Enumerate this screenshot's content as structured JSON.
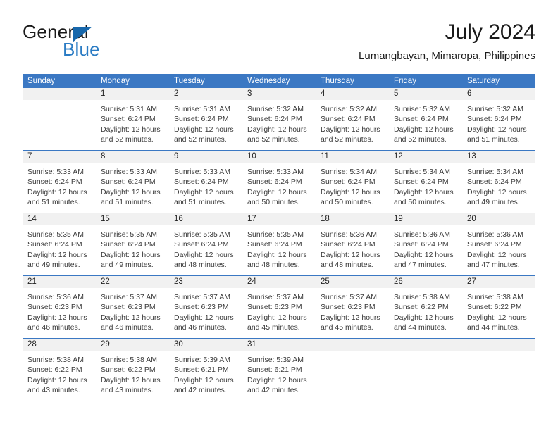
{
  "brand": {
    "name_part1": "General",
    "name_part2": "Blue",
    "triangle_color": "#1767ab",
    "blue_color": "#2b7cc4"
  },
  "header": {
    "title": "July 2024",
    "subtitle": "Lumangbayan, Mimaropa, Philippines"
  },
  "theme": {
    "header_blue": "#3b78c3",
    "daynum_gray": "#f1f1f1",
    "text": "#222222"
  },
  "weekdays": [
    "Sunday",
    "Monday",
    "Tuesday",
    "Wednesday",
    "Thursday",
    "Friday",
    "Saturday"
  ],
  "weeks": [
    [
      {
        "day": "",
        "sunrise": "",
        "sunset": "",
        "daylight1": "",
        "daylight2": ""
      },
      {
        "day": "1",
        "sunrise": "Sunrise: 5:31 AM",
        "sunset": "Sunset: 6:24 PM",
        "daylight1": "Daylight: 12 hours",
        "daylight2": "and 52 minutes."
      },
      {
        "day": "2",
        "sunrise": "Sunrise: 5:31 AM",
        "sunset": "Sunset: 6:24 PM",
        "daylight1": "Daylight: 12 hours",
        "daylight2": "and 52 minutes."
      },
      {
        "day": "3",
        "sunrise": "Sunrise: 5:32 AM",
        "sunset": "Sunset: 6:24 PM",
        "daylight1": "Daylight: 12 hours",
        "daylight2": "and 52 minutes."
      },
      {
        "day": "4",
        "sunrise": "Sunrise: 5:32 AM",
        "sunset": "Sunset: 6:24 PM",
        "daylight1": "Daylight: 12 hours",
        "daylight2": "and 52 minutes."
      },
      {
        "day": "5",
        "sunrise": "Sunrise: 5:32 AM",
        "sunset": "Sunset: 6:24 PM",
        "daylight1": "Daylight: 12 hours",
        "daylight2": "and 52 minutes."
      },
      {
        "day": "6",
        "sunrise": "Sunrise: 5:32 AM",
        "sunset": "Sunset: 6:24 PM",
        "daylight1": "Daylight: 12 hours",
        "daylight2": "and 51 minutes."
      }
    ],
    [
      {
        "day": "7",
        "sunrise": "Sunrise: 5:33 AM",
        "sunset": "Sunset: 6:24 PM",
        "daylight1": "Daylight: 12 hours",
        "daylight2": "and 51 minutes."
      },
      {
        "day": "8",
        "sunrise": "Sunrise: 5:33 AM",
        "sunset": "Sunset: 6:24 PM",
        "daylight1": "Daylight: 12 hours",
        "daylight2": "and 51 minutes."
      },
      {
        "day": "9",
        "sunrise": "Sunrise: 5:33 AM",
        "sunset": "Sunset: 6:24 PM",
        "daylight1": "Daylight: 12 hours",
        "daylight2": "and 51 minutes."
      },
      {
        "day": "10",
        "sunrise": "Sunrise: 5:33 AM",
        "sunset": "Sunset: 6:24 PM",
        "daylight1": "Daylight: 12 hours",
        "daylight2": "and 50 minutes."
      },
      {
        "day": "11",
        "sunrise": "Sunrise: 5:34 AM",
        "sunset": "Sunset: 6:24 PM",
        "daylight1": "Daylight: 12 hours",
        "daylight2": "and 50 minutes."
      },
      {
        "day": "12",
        "sunrise": "Sunrise: 5:34 AM",
        "sunset": "Sunset: 6:24 PM",
        "daylight1": "Daylight: 12 hours",
        "daylight2": "and 50 minutes."
      },
      {
        "day": "13",
        "sunrise": "Sunrise: 5:34 AM",
        "sunset": "Sunset: 6:24 PM",
        "daylight1": "Daylight: 12 hours",
        "daylight2": "and 49 minutes."
      }
    ],
    [
      {
        "day": "14",
        "sunrise": "Sunrise: 5:35 AM",
        "sunset": "Sunset: 6:24 PM",
        "daylight1": "Daylight: 12 hours",
        "daylight2": "and 49 minutes."
      },
      {
        "day": "15",
        "sunrise": "Sunrise: 5:35 AM",
        "sunset": "Sunset: 6:24 PM",
        "daylight1": "Daylight: 12 hours",
        "daylight2": "and 49 minutes."
      },
      {
        "day": "16",
        "sunrise": "Sunrise: 5:35 AM",
        "sunset": "Sunset: 6:24 PM",
        "daylight1": "Daylight: 12 hours",
        "daylight2": "and 48 minutes."
      },
      {
        "day": "17",
        "sunrise": "Sunrise: 5:35 AM",
        "sunset": "Sunset: 6:24 PM",
        "daylight1": "Daylight: 12 hours",
        "daylight2": "and 48 minutes."
      },
      {
        "day": "18",
        "sunrise": "Sunrise: 5:36 AM",
        "sunset": "Sunset: 6:24 PM",
        "daylight1": "Daylight: 12 hours",
        "daylight2": "and 48 minutes."
      },
      {
        "day": "19",
        "sunrise": "Sunrise: 5:36 AM",
        "sunset": "Sunset: 6:24 PM",
        "daylight1": "Daylight: 12 hours",
        "daylight2": "and 47 minutes."
      },
      {
        "day": "20",
        "sunrise": "Sunrise: 5:36 AM",
        "sunset": "Sunset: 6:24 PM",
        "daylight1": "Daylight: 12 hours",
        "daylight2": "and 47 minutes."
      }
    ],
    [
      {
        "day": "21",
        "sunrise": "Sunrise: 5:36 AM",
        "sunset": "Sunset: 6:23 PM",
        "daylight1": "Daylight: 12 hours",
        "daylight2": "and 46 minutes."
      },
      {
        "day": "22",
        "sunrise": "Sunrise: 5:37 AM",
        "sunset": "Sunset: 6:23 PM",
        "daylight1": "Daylight: 12 hours",
        "daylight2": "and 46 minutes."
      },
      {
        "day": "23",
        "sunrise": "Sunrise: 5:37 AM",
        "sunset": "Sunset: 6:23 PM",
        "daylight1": "Daylight: 12 hours",
        "daylight2": "and 46 minutes."
      },
      {
        "day": "24",
        "sunrise": "Sunrise: 5:37 AM",
        "sunset": "Sunset: 6:23 PM",
        "daylight1": "Daylight: 12 hours",
        "daylight2": "and 45 minutes."
      },
      {
        "day": "25",
        "sunrise": "Sunrise: 5:37 AM",
        "sunset": "Sunset: 6:23 PM",
        "daylight1": "Daylight: 12 hours",
        "daylight2": "and 45 minutes."
      },
      {
        "day": "26",
        "sunrise": "Sunrise: 5:38 AM",
        "sunset": "Sunset: 6:22 PM",
        "daylight1": "Daylight: 12 hours",
        "daylight2": "and 44 minutes."
      },
      {
        "day": "27",
        "sunrise": "Sunrise: 5:38 AM",
        "sunset": "Sunset: 6:22 PM",
        "daylight1": "Daylight: 12 hours",
        "daylight2": "and 44 minutes."
      }
    ],
    [
      {
        "day": "28",
        "sunrise": "Sunrise: 5:38 AM",
        "sunset": "Sunset: 6:22 PM",
        "daylight1": "Daylight: 12 hours",
        "daylight2": "and 43 minutes."
      },
      {
        "day": "29",
        "sunrise": "Sunrise: 5:38 AM",
        "sunset": "Sunset: 6:22 PM",
        "daylight1": "Daylight: 12 hours",
        "daylight2": "and 43 minutes."
      },
      {
        "day": "30",
        "sunrise": "Sunrise: 5:39 AM",
        "sunset": "Sunset: 6:21 PM",
        "daylight1": "Daylight: 12 hours",
        "daylight2": "and 42 minutes."
      },
      {
        "day": "31",
        "sunrise": "Sunrise: 5:39 AM",
        "sunset": "Sunset: 6:21 PM",
        "daylight1": "Daylight: 12 hours",
        "daylight2": "and 42 minutes."
      },
      {
        "day": "",
        "sunrise": "",
        "sunset": "",
        "daylight1": "",
        "daylight2": ""
      },
      {
        "day": "",
        "sunrise": "",
        "sunset": "",
        "daylight1": "",
        "daylight2": ""
      },
      {
        "day": "",
        "sunrise": "",
        "sunset": "",
        "daylight1": "",
        "daylight2": ""
      }
    ]
  ]
}
